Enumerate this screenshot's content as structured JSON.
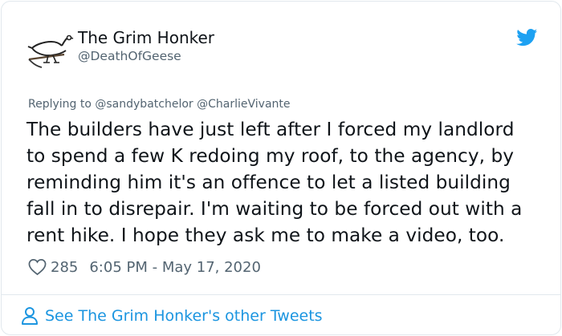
{
  "tweet": {
    "author": {
      "display_name": "The Grim Honker",
      "handle": "@DeathOfGeese",
      "avatar_icon": "goose-scythe-drawing"
    },
    "platform_icon": "twitter-bird-icon",
    "replying_to": {
      "prefix": "Replying to",
      "mentions": [
        "@sandybatchelor",
        "@CharlieVivante"
      ]
    },
    "text_lines": [
      "The builders have just left after I forced my landlord",
      "to spend a few K redoing my roof, to the agency, by",
      "reminding him it's an offence to let a listed building",
      "fall in to disrepair. I'm waiting to be forced out with a",
      "rent hike. I hope they ask me to make a video, too."
    ],
    "likes": "285",
    "timestamp": "6:05 PM - May 17, 2020",
    "footer_link": "See The Grim Honker's other Tweets"
  },
  "colors": {
    "text": "#0f1419",
    "muted": "#536471",
    "accent": "#1b95e0",
    "border": "#e1e8ed"
  }
}
